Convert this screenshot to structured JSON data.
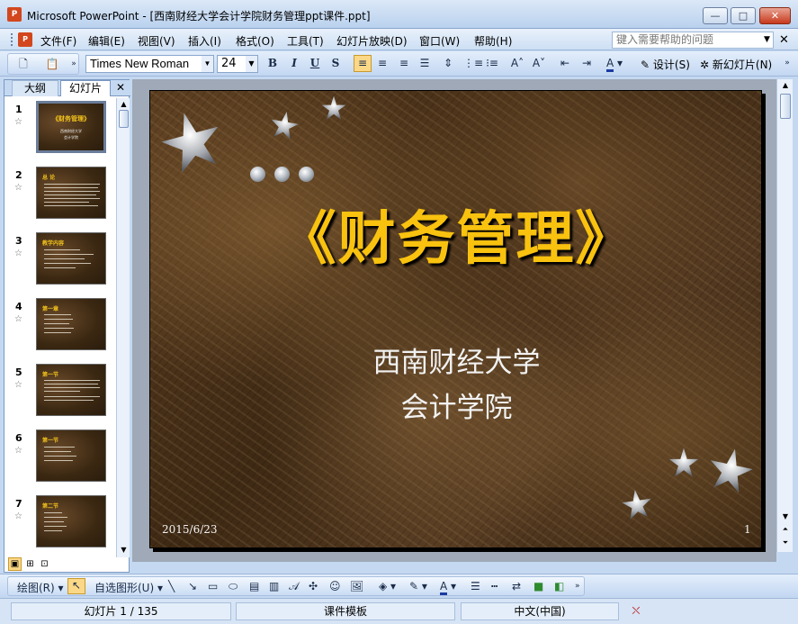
{
  "window": {
    "title": "Microsoft PowerPoint - [西南财经大学会计学院财务管理ppt课件.ppt]",
    "app_icon_label": "P",
    "min_label": "—",
    "max_label": "□",
    "close_label": "✕"
  },
  "menu": {
    "items": [
      "文件(F)",
      "编辑(E)",
      "视图(V)",
      "插入(I)",
      "格式(O)",
      "工具(T)",
      "幻灯片放映(D)",
      "窗口(W)",
      "帮助(H)"
    ],
    "help_placeholder": "键入需要帮助的问题",
    "close_doc": "✕"
  },
  "toolbar": {
    "font_name": "Times New Roman",
    "font_size": "24",
    "bold": "B",
    "italic": "I",
    "underline": "U",
    "shadow": "S",
    "design_label": "设计(S)",
    "new_slide_label": "新幻灯片(N)"
  },
  "left_pane": {
    "tab_outline": "大纲",
    "tab_slides": "幻灯片",
    "tab_close": "✕",
    "star_glyph": "☆",
    "thumbnails": [
      {
        "num": "1",
        "title": "《财务管理》",
        "sub1": "西南财经大学",
        "sub2": "会计学院"
      },
      {
        "num": "2",
        "title": "总  论"
      },
      {
        "num": "3",
        "title": "教学内容"
      },
      {
        "num": "4",
        "title": "第一章"
      },
      {
        "num": "5",
        "title": "第一节"
      },
      {
        "num": "6",
        "title": "第一节"
      },
      {
        "num": "7",
        "title": "第二节"
      }
    ]
  },
  "slide": {
    "title": "《财务管理》",
    "subtitle_line1": "西南财经大学",
    "subtitle_line2": "会计学院",
    "date": "2015/6/23",
    "number": "1"
  },
  "drawbar": {
    "draw_label": "绘图(R)",
    "autoshape_label": "自选图形(U)"
  },
  "status": {
    "slide_info": "幻灯片 1 / 135",
    "template": "课件模板",
    "language": "中文(中国)"
  }
}
